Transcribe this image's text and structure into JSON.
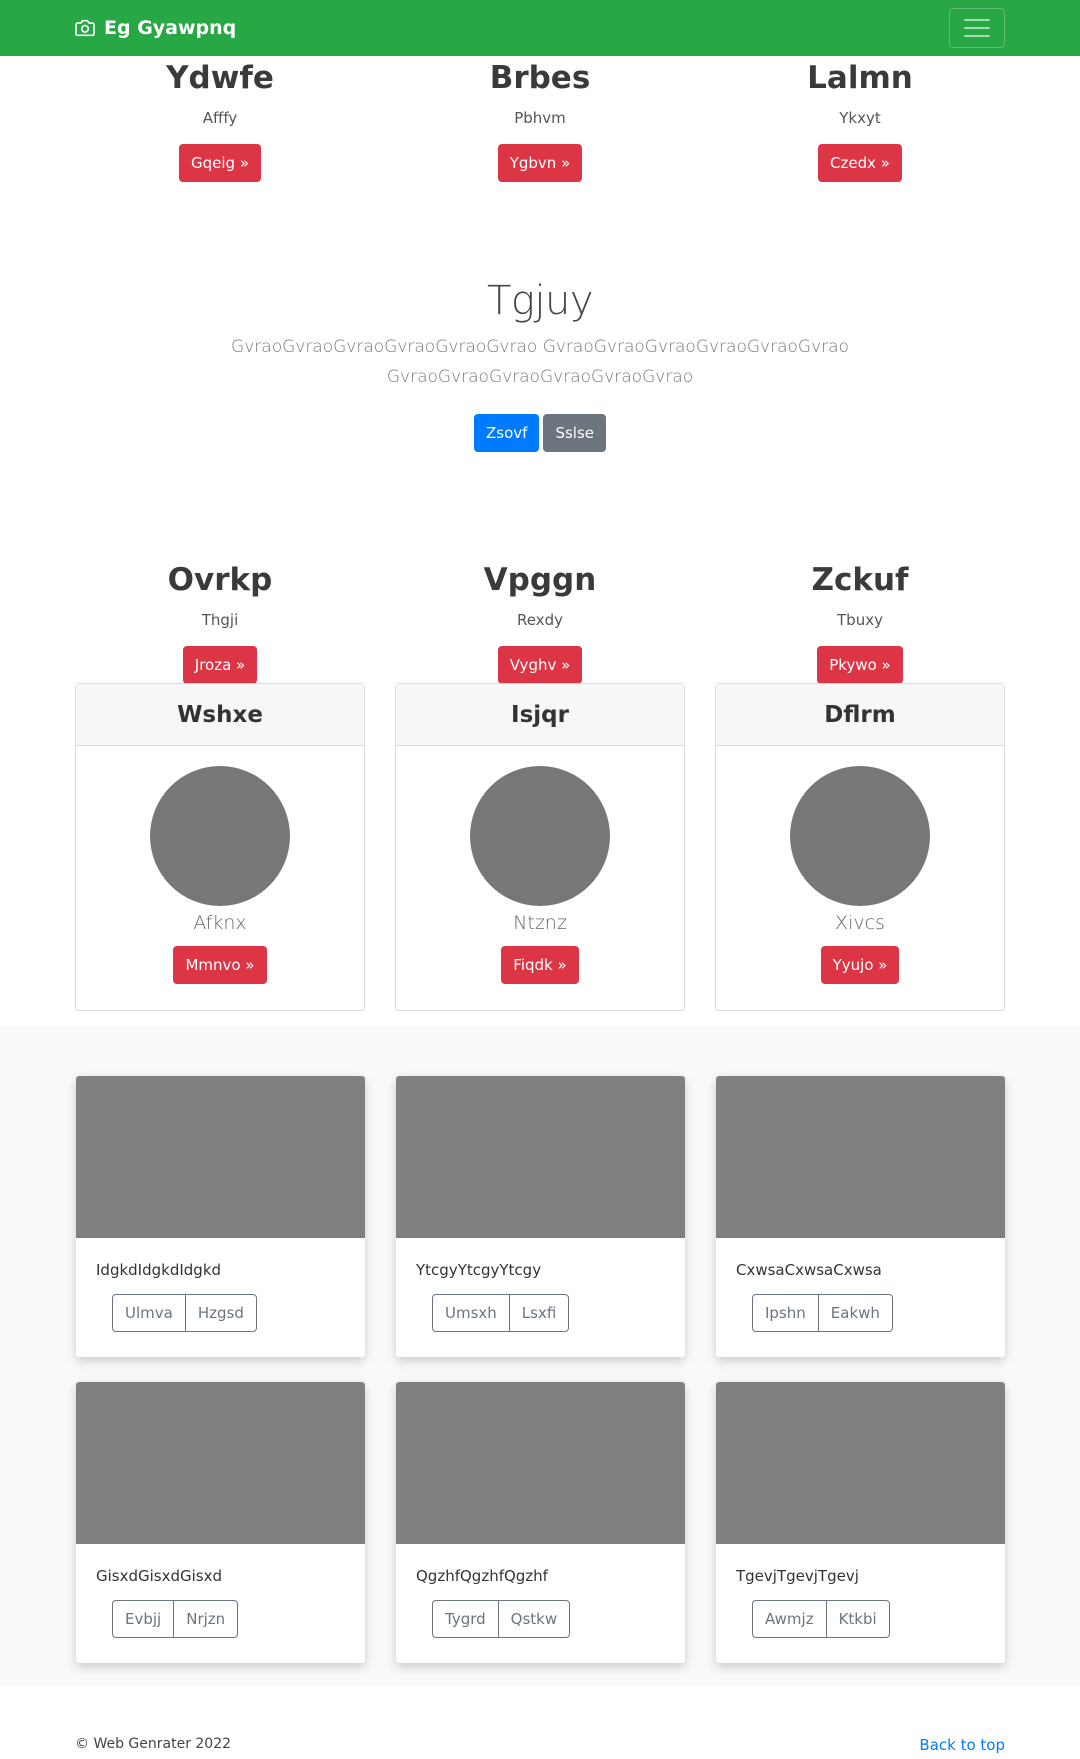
{
  "navbar": {
    "brand": "Eg Gyawpnq",
    "bg": "#28a745"
  },
  "top_columns": [
    {
      "heading": "Ydwfe",
      "subtitle": "Afffy",
      "button": "Gqeig »"
    },
    {
      "heading": "Brbes",
      "subtitle": "Pbhvm",
      "button": "Ygbvn »"
    },
    {
      "heading": "Lalmn",
      "subtitle": "Ykxyt",
      "button": "Czedx »"
    }
  ],
  "jumbotron": {
    "title": "Tgjuy",
    "text": "GvraoGvraoGvraoGvraoGvraoGvrao GvraoGvraoGvraoGvraoGvraoGvrao GvraoGvraoGvraoGvraoGvraoGvrao",
    "primary_button": "Zsovf",
    "secondary_button": "Sslse"
  },
  "mid_columns": [
    {
      "heading": "Ovrkp",
      "subtitle": "Thgji",
      "button": "Jroza »"
    },
    {
      "heading": "Vpggn",
      "subtitle": "Rexdy",
      "button": "Vyghv »"
    },
    {
      "heading": "Zckuf",
      "subtitle": "Tbuxy",
      "button": "Pkywo »"
    }
  ],
  "profile_cards": [
    {
      "header": "Wshxe",
      "name": "Afknx",
      "button": "Mmnvo »"
    },
    {
      "header": "Isjqr",
      "name": "Ntznz",
      "button": "Fiqdk »"
    },
    {
      "header": "Dflrm",
      "name": "Xivcs",
      "button": "Yyujo »"
    }
  ],
  "album_cards": [
    {
      "text": "IdgkdIdgkdIdgkd",
      "btn1": "Ulmva",
      "btn2": "Hzgsd"
    },
    {
      "text": "YtcgyYtcgyYtcgy",
      "btn1": "Umsxh",
      "btn2": "Lsxfi"
    },
    {
      "text": "CxwsaCxwsaCxwsa",
      "btn1": "Ipshn",
      "btn2": "Eakwh"
    },
    {
      "text": "GisxdGisxdGisxd",
      "btn1": "Evbjj",
      "btn2": "Nrjzn"
    },
    {
      "text": "QgzhfQgzhfQgzhf",
      "btn1": "Tygrd",
      "btn2": "Qstkw"
    },
    {
      "text": "TgevjTgevjTgevj",
      "btn1": "Awmjz",
      "btn2": "Ktkbi"
    }
  ],
  "footer": {
    "copyright": "© Web Genrater 2022",
    "back_to_top": "Back to top"
  },
  "colors": {
    "danger": "#dc3545",
    "primary": "#007bff",
    "secondary": "#6c757d"
  }
}
